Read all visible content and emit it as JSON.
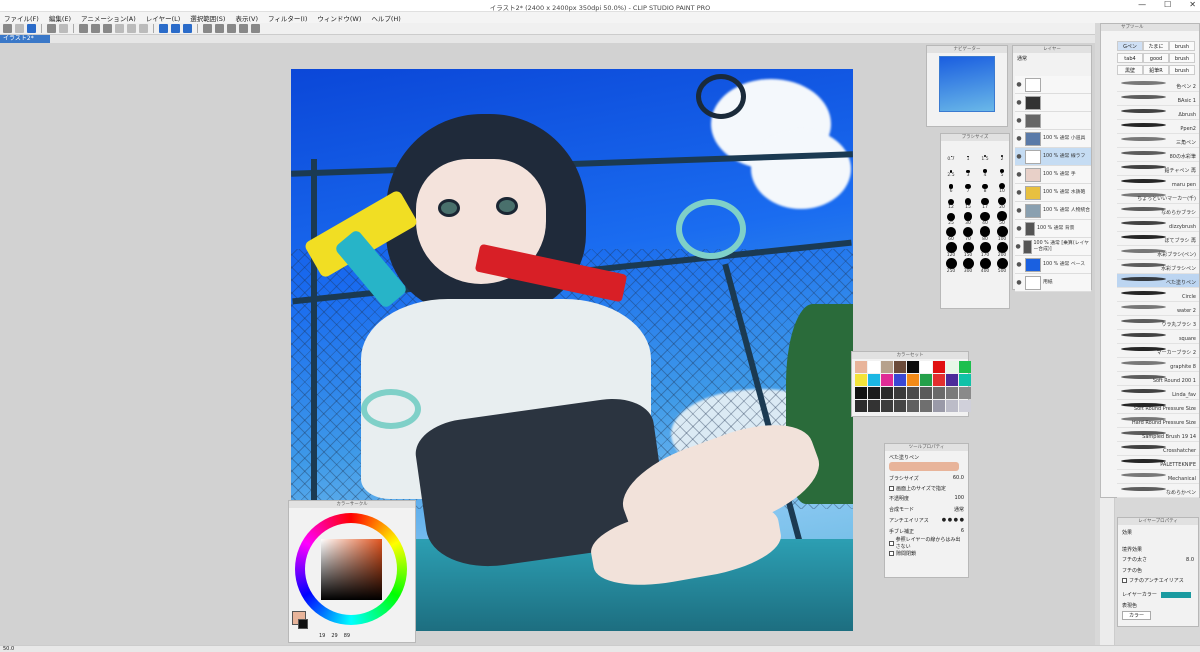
{
  "window": {
    "title": "イラスト2* (2400 x 2400px 350dpi 50.0%)  - CLIP STUDIO PAINT PRO",
    "min": "—",
    "max": "☐",
    "close": "✕"
  },
  "menu": [
    "ファイル(F)",
    "編集(E)",
    "アニメーション(A)",
    "レイヤー(L)",
    "選択範囲(S)",
    "表示(V)",
    "フィルター(I)",
    "ウィンドウ(W)",
    "ヘルプ(H)"
  ],
  "doc_tab": "イラスト2*",
  "navigator": {
    "title": "ナビゲーター"
  },
  "layer_panel": {
    "title": "レイヤー",
    "blend_mode": "通常",
    "layers": [
      {
        "label": ""
      },
      {
        "label": ""
      },
      {
        "label": ""
      },
      {
        "label": "100 % 通常 小道具"
      },
      {
        "label": "100 % 通常 線ラフ"
      },
      {
        "label": "100 % 通常 手"
      },
      {
        "label": "100 % 通常 水鉄砲"
      },
      {
        "label": "100 % 通常 人物統合"
      },
      {
        "label": "100 % 通常 背景"
      },
      {
        "label": "100 % 通常 [乗算(レイヤー合成)]"
      },
      {
        "label": "100 % 通常 ベース"
      },
      {
        "label": "用紙"
      }
    ]
  },
  "brush_size": {
    "title": "ブラシサイズ",
    "sizes": [
      "0.7",
      "1",
      "1.5",
      "2",
      "2.5",
      "3",
      "4",
      "5",
      "6",
      "7",
      "8",
      "10",
      "12",
      "15",
      "17",
      "20",
      "25",
      "30",
      "40",
      "50",
      "60",
      "70",
      "80",
      "100",
      "120",
      "150",
      "170",
      "200",
      "250",
      "300",
      "400",
      "500"
    ]
  },
  "color_set": {
    "title": "カラーセット",
    "colors": [
      "#e8b49a",
      "#ffffff",
      "#b6a18c",
      "#6b4b3a",
      "#0b0b0b",
      "#ffffff",
      "#e01010",
      "#e7f7e8",
      "#1dbf4e",
      "#f2e33a",
      "#1cb7e3",
      "#e02b96",
      "#3a48d4",
      "#f28a17",
      "#25a04a",
      "#e22f2f",
      "#4c2b9a",
      "#11c2a8",
      "#121212",
      "#1c1c1c",
      "#2a2a2a",
      "#3a3a3a",
      "#4a4a4a",
      "#5a5a5a",
      "#6a6a6a",
      "#7a7a7a",
      "#8a8a8a",
      "#2c2c2c",
      "#333333",
      "#3c3c3c",
      "#454545",
      "#5f5f5f",
      "#6f6f6f",
      "#9a9aa8",
      "#bcbcc8",
      "#d0d0da"
    ]
  },
  "tool_property": {
    "title": "ツールプロパティ",
    "brush": "べた塗りペン",
    "size_label": "ブラシサイズ",
    "size_value": "60.0",
    "screen_size_label": "画面上のサイズで指定",
    "opacity_label": "不透明度",
    "opacity_value": "100",
    "blend_label": "合成モード",
    "blend_value": "通常",
    "aa_label": "アンチエイリアス",
    "stabilize_label": "手ブレ補正",
    "stabilize_value": "6",
    "ref_label": "参照レイヤーの線からはみ出さない",
    "gap_label": "隙間閉鎖"
  },
  "color_circle": {
    "title": "カラーサークル",
    "h": "19",
    "s": "29",
    "v": "89"
  },
  "subtool": {
    "title": "サブツール",
    "tabs": [
      "Gペン",
      "たまに",
      "brush",
      "tab4",
      "good",
      "brush",
      "黒壁",
      "鉛筆R",
      "brush"
    ],
    "brushes": [
      "色ペン 2",
      "BAsic 1",
      "Δbrush",
      "Ppen2",
      "三角ペン",
      "80の水彩筆",
      "鉛チャペン 再",
      "maru pen",
      "ちょっといいマーカー(千)",
      "なめらかブラシ",
      "dizzybrush",
      "ぼてブラシ 再",
      "水彩ブラシ(ペン)",
      "水彩ブラシペン",
      "べた塗りペン",
      "Circle",
      "water 2",
      "ウラ丸ブラシ 3",
      "square",
      "マーカーブラシ 2",
      "graphite 8",
      "Soft Round 200 1",
      "Linda_fav",
      "Soft Round Pressure Size",
      "Hard Round Pressure Size",
      "Sampled Brush 19 14",
      "Crosshatcher",
      "PALETTEKNIFE",
      "Mechanical",
      "なめらかペン"
    ],
    "selected": "べた塗りペン"
  },
  "layer_property": {
    "title": "レイヤープロパティ",
    "effect_label": "効果",
    "border_label": "境界効果",
    "width_label": "フチの太さ",
    "width_value": "8.0",
    "color_label": "フチの色",
    "aa_label": "フチのアンチエイリアス",
    "layer_color_label": "レイヤーカラー",
    "display_label": "表現色",
    "display_value": "カラー"
  },
  "status": {
    "zoom": "50.0"
  }
}
